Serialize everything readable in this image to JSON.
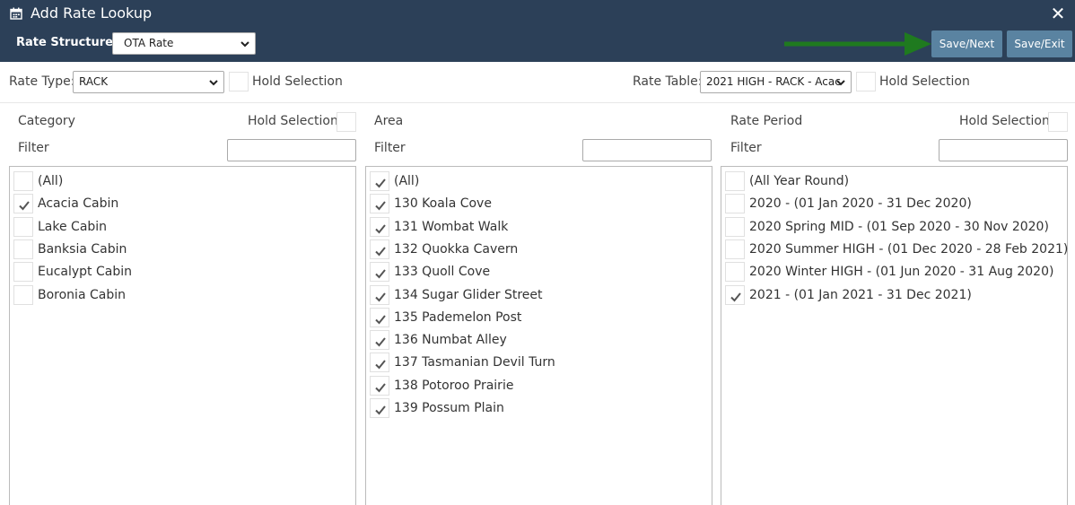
{
  "header": {
    "title": "Add Rate Lookup",
    "title_icon": "calendar-icon",
    "close_glyph": "✕",
    "rate_structure_label": "Rate Structure:",
    "rate_structure_value": "OTA Rate",
    "save_next_label": "Save/Next",
    "save_exit_label": "Save/Exit"
  },
  "toolbar": {
    "rate_type_label": "Rate Type:",
    "rate_type_value": "RACK",
    "rate_table_label": "Rate Table:",
    "rate_table_value": "2021 HIGH - RACK - Acac",
    "hold_selection_label": "Hold Selection"
  },
  "columns": [
    {
      "title": "Category",
      "hold_label": "Hold Selection",
      "filter_label": "Filter",
      "items": [
        {
          "label": "(All)",
          "checked": false
        },
        {
          "label": "Acacia Cabin",
          "checked": true
        },
        {
          "label": "Lake Cabin",
          "checked": false
        },
        {
          "label": "Banksia Cabin",
          "checked": false
        },
        {
          "label": "Eucalypt Cabin",
          "checked": false
        },
        {
          "label": "Boronia Cabin",
          "checked": false
        }
      ]
    },
    {
      "title": "Area",
      "hold_label": "",
      "filter_label": "Filter",
      "items": [
        {
          "label": "(All)",
          "checked": true
        },
        {
          "label": "130 Koala Cove",
          "checked": true
        },
        {
          "label": "131 Wombat Walk",
          "checked": true
        },
        {
          "label": "132 Quokka Cavern",
          "checked": true
        },
        {
          "label": "133 Quoll Cove",
          "checked": true
        },
        {
          "label": "134 Sugar Glider Street",
          "checked": true
        },
        {
          "label": "135 Pademelon Post",
          "checked": true
        },
        {
          "label": "136 Numbat Alley",
          "checked": true
        },
        {
          "label": "137 Tasmanian Devil Turn",
          "checked": true
        },
        {
          "label": "138 Potoroo Prairie",
          "checked": true
        },
        {
          "label": "139 Possum Plain",
          "checked": true
        }
      ]
    },
    {
      "title": "Rate Period",
      "hold_label": "Hold Selection",
      "filter_label": "Filter",
      "items": [
        {
          "label": "(All Year Round)",
          "checked": false
        },
        {
          "label": "2020 - (01 Jan 2020 - 31 Dec 2020)",
          "checked": false
        },
        {
          "label": "2020 Spring MID - (01 Sep 2020 - 30 Nov 2020)",
          "checked": false
        },
        {
          "label": "2020 Summer HIGH - (01 Dec 2020 - 28 Feb 2021)",
          "checked": false
        },
        {
          "label": "2020 Winter HIGH - (01 Jun 2020 - 31 Aug 2020)",
          "checked": false
        },
        {
          "label": "2021 - (01 Jan 2021 - 31 Dec 2021)",
          "checked": true
        }
      ]
    }
  ],
  "colors": {
    "header_bg": "#2c4058",
    "button_bg": "#5a83a1",
    "arrow": "#1f7a1f"
  }
}
